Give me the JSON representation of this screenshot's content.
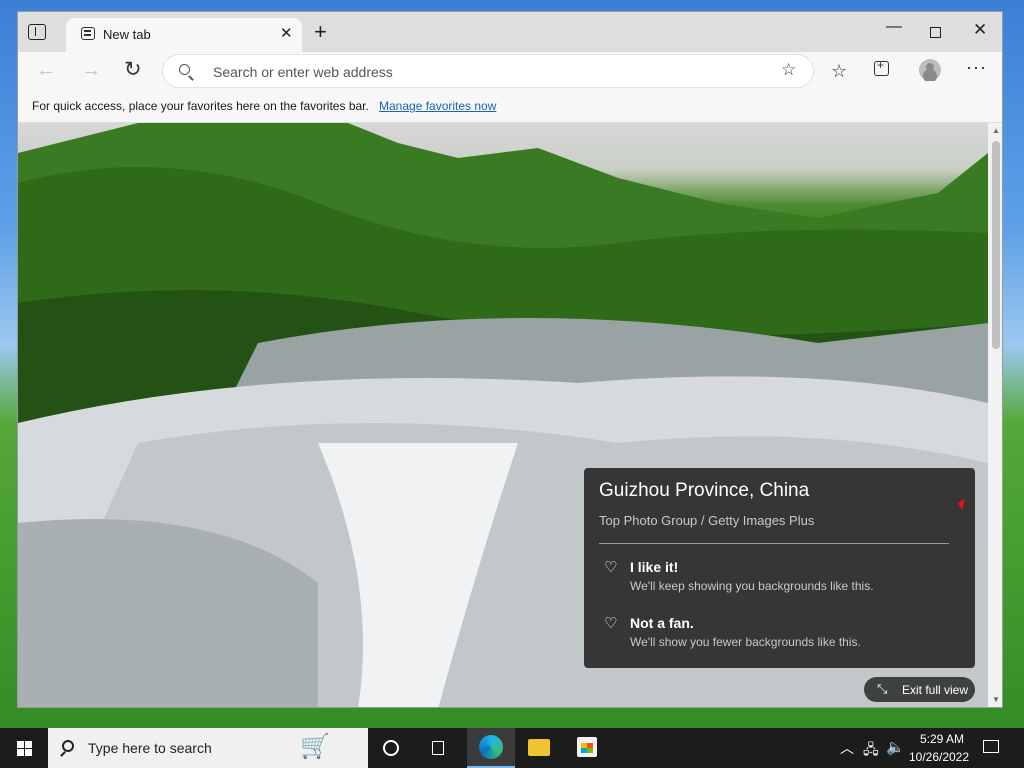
{
  "browser": {
    "tab_title": "New tab",
    "address_placeholder": "Search or enter web address",
    "favbar_text": "For quick access, place your favorites here on the favorites bar.",
    "favbar_link": "Manage favorites now"
  },
  "card": {
    "title": "Guizhou Province, China",
    "credit": "Top Photo Group / Getty Images Plus",
    "like_title": "I like it!",
    "like_desc": "We'll keep showing you backgrounds like this.",
    "dislike_title": "Not a fan.",
    "dislike_desc": "We'll show you fewer backgrounds like this."
  },
  "exit_full_view": "Exit full view",
  "taskbar": {
    "search_text": "Type here to search",
    "time": "5:29 AM",
    "date": "10/26/2022"
  }
}
